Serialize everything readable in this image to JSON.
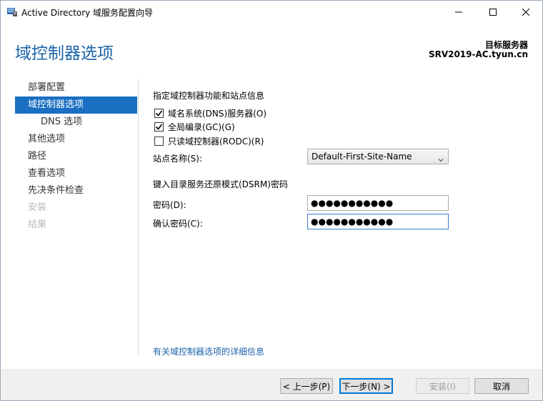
{
  "window": {
    "title": "Active Directory 域服务配置向导"
  },
  "header": {
    "page_title": "域控制器选项",
    "target_label": "目标服务器",
    "target_name": "SRV2019-AC.tyun.cn"
  },
  "nav": {
    "items": [
      {
        "label": "部署配置",
        "state": "normal"
      },
      {
        "label": "域控制器选项",
        "state": "active"
      },
      {
        "label": "DNS 选项",
        "state": "sub"
      },
      {
        "label": "其他选项",
        "state": "normal"
      },
      {
        "label": "路径",
        "state": "normal"
      },
      {
        "label": "查看选项",
        "state": "normal"
      },
      {
        "label": "先决条件检查",
        "state": "normal"
      },
      {
        "label": "安装",
        "state": "disabled"
      },
      {
        "label": "结果",
        "state": "disabled"
      }
    ]
  },
  "content": {
    "capabilities_label": "指定域控制器功能和站点信息",
    "dns_checkbox": {
      "label": "域名系统(DNS)服务器(O)",
      "checked": true
    },
    "gc_checkbox": {
      "label": "全局编录(GC)(G)",
      "checked": true
    },
    "rodc_checkbox": {
      "label": "只读域控制器(RODC)(R)",
      "checked": false
    },
    "site_label": "站点名称(S):",
    "site_value": "Default-First-Site-Name",
    "dsrm_label": "键入目录服务还原模式(DSRM)密码",
    "password_label": "密码(D):",
    "password_value": "●●●●●●●●●●●",
    "confirm_label": "确认密码(C):",
    "confirm_value": "●●●●●●●●●●●",
    "more_link": "有关域控制器选项的详细信息"
  },
  "footer": {
    "prev_label": "< 上一步(P)",
    "next_label": "下一步(N) >",
    "install_label": "安装(I)",
    "cancel_label": "取消"
  },
  "colors": {
    "accent": "#1a6fc2",
    "title_blue": "#1b63a8"
  }
}
